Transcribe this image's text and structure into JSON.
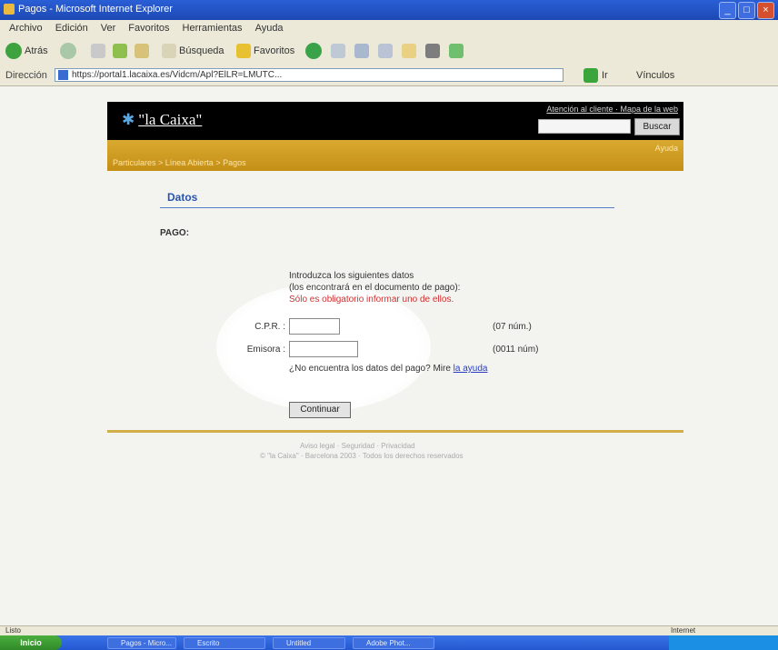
{
  "window": {
    "title": "Pagos - Microsoft Internet Explorer",
    "minimize_glyph": "_",
    "maximize_glyph": "□",
    "close_glyph": "×"
  },
  "menu": [
    "Archivo",
    "Edición",
    "Ver",
    "Favoritos",
    "Herramientas",
    "Ayuda"
  ],
  "toolbar": {
    "back_label": "Atrás",
    "search_label": "Búsqueda",
    "favorites_label": "Favoritos"
  },
  "address": {
    "label": "Dirección",
    "url": "https://portal1.lacaixa.es/Vidcm/Apl?ElLR=LMUTC...",
    "go_label": "Ir",
    "links_label": "Vínculos"
  },
  "site": {
    "logo_text": "\"la Caixa\"",
    "top_links": "Atención al cliente · Mapa de la web",
    "search_button": "Buscar",
    "breadcrumb": "Particulares > Línea Abierta > Pagos",
    "gold_right": "Ayuda"
  },
  "page": {
    "section_title": "Datos",
    "pago_label": "PAGO:",
    "instructions": [
      "Introduzca los siguientes datos",
      "(los encontrará en el documento de pago):",
      "Sólo es obligatorio informar uno de ellos."
    ],
    "cpr_label": "C.P.R. :",
    "cpr_hint": "(07 núm.)",
    "emisora_label": "Emisora :",
    "emisora_hint": "(0011 núm)",
    "help_prefix": "¿No encuentra los datos del pago? Mire ",
    "help_link": "la ayuda",
    "continue_label": "Continuar",
    "footer_line1": "Aviso legal · Seguridad · Privacidad",
    "footer_line2": "© \"la Caixa\" · Barcelona 2003 · Todos los derechos reservados"
  },
  "status": {
    "left": "Listo",
    "zone": "Internet"
  },
  "taskbar": {
    "start": "Inicio",
    "buttons": [
      "Pagos - Micro...",
      "Escrito",
      "Untitled",
      "Adobe Phot..."
    ]
  },
  "colors": {
    "header_black": "#000000",
    "gold": "#d4a12a",
    "title_blue": "#2555b3",
    "warning_red": "#d03030"
  }
}
